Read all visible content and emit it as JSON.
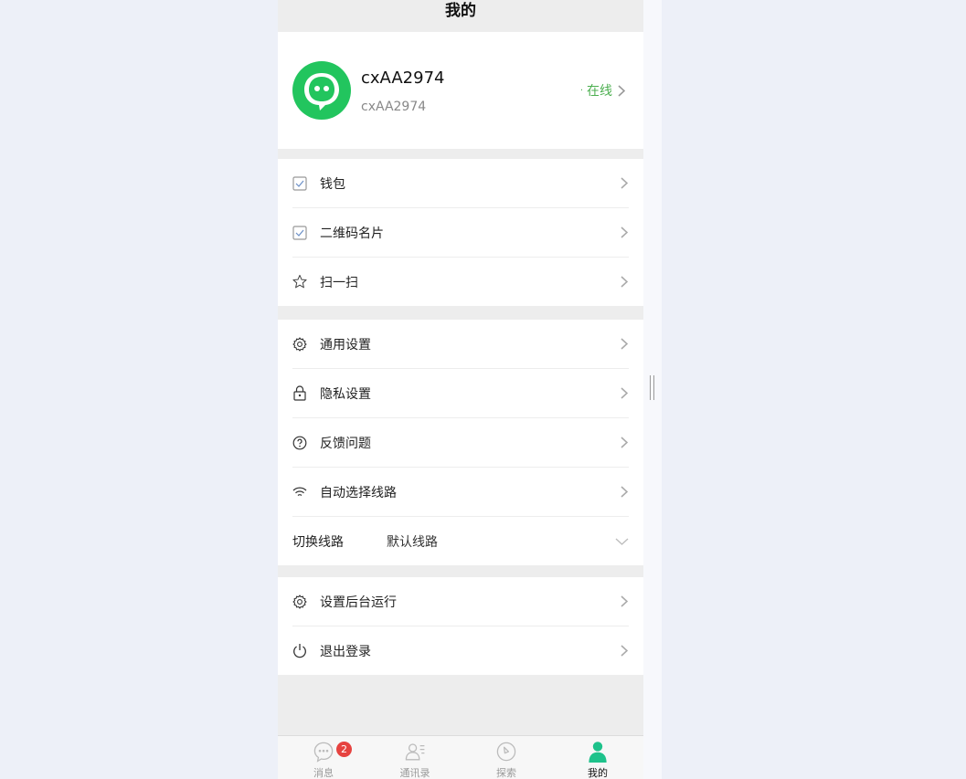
{
  "header": {
    "title": "我的"
  },
  "profile": {
    "name": "cxAA2974",
    "id": "cxAA2974",
    "status": "在线",
    "status_color": "#4caf50",
    "avatar_color": "#22c55e"
  },
  "menu_group_1": [
    {
      "label": "钱包",
      "icon": "checkbox-icon"
    },
    {
      "label": "二维码名片",
      "icon": "checkbox-icon"
    },
    {
      "label": "扫一扫",
      "icon": "star-icon"
    }
  ],
  "menu_group_2": [
    {
      "label": "通用设置",
      "icon": "gear-icon"
    },
    {
      "label": "隐私设置",
      "icon": "lock-icon"
    },
    {
      "label": "反馈问题",
      "icon": "question-icon"
    },
    {
      "label": "自动选择线路",
      "icon": "wifi-icon"
    }
  ],
  "route_select": {
    "label": "切换线路",
    "value": "默认线路"
  },
  "menu_group_3": [
    {
      "label": "设置后台运行",
      "icon": "gear-icon"
    },
    {
      "label": "退出登录",
      "icon": "power-icon"
    }
  ],
  "tabbar": [
    {
      "label": "消息",
      "icon": "chat-icon",
      "badge": "2"
    },
    {
      "label": "通讯录",
      "icon": "contacts-icon"
    },
    {
      "label": "探索",
      "icon": "compass-icon"
    },
    {
      "label": "我的",
      "icon": "person-icon",
      "active": true
    }
  ],
  "colors": {
    "accent": "#1ec28b",
    "badge": "#e64340"
  }
}
